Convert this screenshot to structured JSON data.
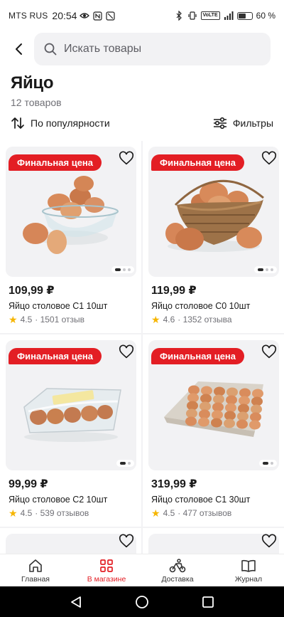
{
  "status_bar": {
    "carrier": "MTS RUS",
    "time": "20:54",
    "battery": "60 %",
    "battery_level": 0.6,
    "volte": "VoLTE"
  },
  "search": {
    "placeholder": "Искать товары"
  },
  "page": {
    "title": "Яйцо",
    "count": "12 товаров"
  },
  "controls": {
    "sort_label": "По популярности",
    "filter_label": "Фильтры"
  },
  "products": [
    {
      "badge": "Финальная цена",
      "price": "109,99 ₽",
      "name": "Яйцо столовое С1 10шт",
      "rating": "4.5",
      "reviews": "· 1501 отзыв",
      "image": "eggs-in-glass-bowl",
      "slide": 1,
      "slides": 3
    },
    {
      "badge": "Финальная цена",
      "price": "119,99 ₽",
      "name": "Яйцо столовое С0 10шт",
      "rating": "4.6",
      "reviews": "· 1352 отзыва",
      "image": "eggs-in-wicker-basket",
      "slide": 1,
      "slides": 3
    },
    {
      "badge": "Финальная цена",
      "price": "99,99 ₽",
      "name": "Яйцо столовое С2 10шт",
      "rating": "4.5",
      "reviews": "· 539 отзывов",
      "image": "eggs-in-plastic-carton",
      "slide": 1,
      "slides": 2
    },
    {
      "badge": "Финальная цена",
      "price": "319,99 ₽",
      "name": "Яйцо столовое С1 30шт",
      "rating": "4.5",
      "reviews": "· 477 отзывов",
      "image": "eggs-in-paper-tray",
      "slide": 1,
      "slides": 2
    }
  ],
  "bottom_nav": [
    {
      "label": "Главная",
      "icon": "home-icon"
    },
    {
      "label": "В магазине",
      "icon": "grid-icon",
      "active": true
    },
    {
      "label": "Доставка",
      "icon": "courier-bike-icon"
    },
    {
      "label": "Журнал",
      "icon": "book-icon"
    }
  ],
  "colors": {
    "accent": "#e31e24",
    "star": "#f6b500"
  }
}
